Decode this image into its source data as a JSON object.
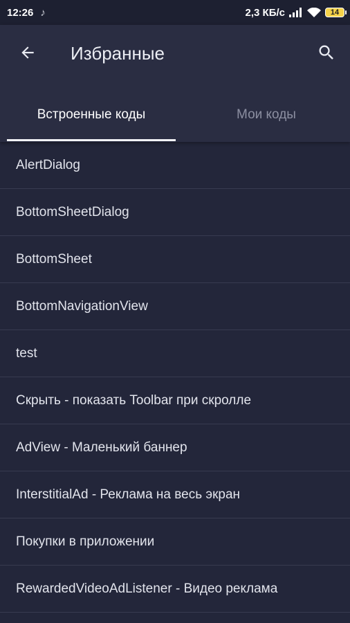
{
  "status_bar": {
    "time": "12:26",
    "network_speed": "2,3 КБ/с",
    "battery_level": "14"
  },
  "app_bar": {
    "title": "Избранные",
    "back_icon": "arrow-back-icon",
    "search_icon": "search-icon"
  },
  "tabs": [
    {
      "label": "Встроенные коды",
      "selected": true
    },
    {
      "label": "Мои коды",
      "selected": false
    }
  ],
  "list": {
    "items": [
      "AlertDialog",
      "BottomSheetDialog",
      "BottomSheet",
      "BottomNavigationView",
      "test",
      "Скрыть - показать Toolbar при скролле",
      "AdView - Маленький баннер",
      "InterstitialAd - Реклама на весь экран",
      "Покупки в приложении",
      "RewardedVideoAdListener - Видео реклама"
    ]
  },
  "colors": {
    "background": "#23263a",
    "app_bar": "#2a2d42",
    "status_bar": "#1d2031",
    "divider": "#383b50",
    "tab_selected": "#ffffff",
    "tab_unselected": "#8c8fa1",
    "battery": "#f6d34a"
  }
}
